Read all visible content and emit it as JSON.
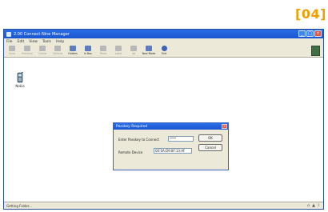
{
  "badge": "[04]",
  "window": {
    "title": "2.00 Connect Nine Manager",
    "controls": {
      "minimize": "_",
      "maximize": "□",
      "close": "×"
    }
  },
  "menu": [
    {
      "label": "File"
    },
    {
      "label": "Edit"
    },
    {
      "label": "View"
    },
    {
      "label": "Tools"
    },
    {
      "label": "Help"
    }
  ],
  "toolbar": [
    {
      "label": "Save",
      "icon": "save-icon",
      "active": false
    },
    {
      "label": "Previous",
      "icon": "previous-icon",
      "active": false
    },
    {
      "label": "Cancel",
      "icon": "cancel-icon",
      "active": false
    },
    {
      "label": "Options",
      "icon": "options-icon",
      "active": false
    },
    {
      "label": "Folders",
      "icon": "folders-icon",
      "active": true
    },
    {
      "label": "In Box",
      "icon": "inbox-icon",
      "active": true
    },
    {
      "label": "Paste",
      "icon": "paste-icon",
      "active": false
    },
    {
      "label": "Label",
      "icon": "label-icon",
      "active": false
    },
    {
      "label": "Up",
      "icon": "up-icon",
      "active": false
    },
    {
      "label": "New Mode",
      "icon": "new-mode-icon",
      "active": true
    },
    {
      "label": "Exit",
      "icon": "exit-icon",
      "active": true
    }
  ],
  "device": {
    "label": "Nokia",
    "icon": "phone-icon"
  },
  "dialog": {
    "title": "Passkey Required",
    "passkey_label": "Enter Passkey to Connect",
    "passkey_value": "****",
    "remote_label": "Remote Device",
    "remote_value": "00:0A:D9:8F:13:AF",
    "ok_label": "OK",
    "cancel_label": "Cancel",
    "close_glyph": "×"
  },
  "status": {
    "text": "Getting Folder...",
    "icons": [
      "network-icon",
      "signal-icon",
      "bluetooth-icon"
    ]
  },
  "colors": {
    "titlebar": "#1a55cf",
    "chrome": "#ece9d8",
    "badge": "#f0a000",
    "close": "#e2553e"
  }
}
